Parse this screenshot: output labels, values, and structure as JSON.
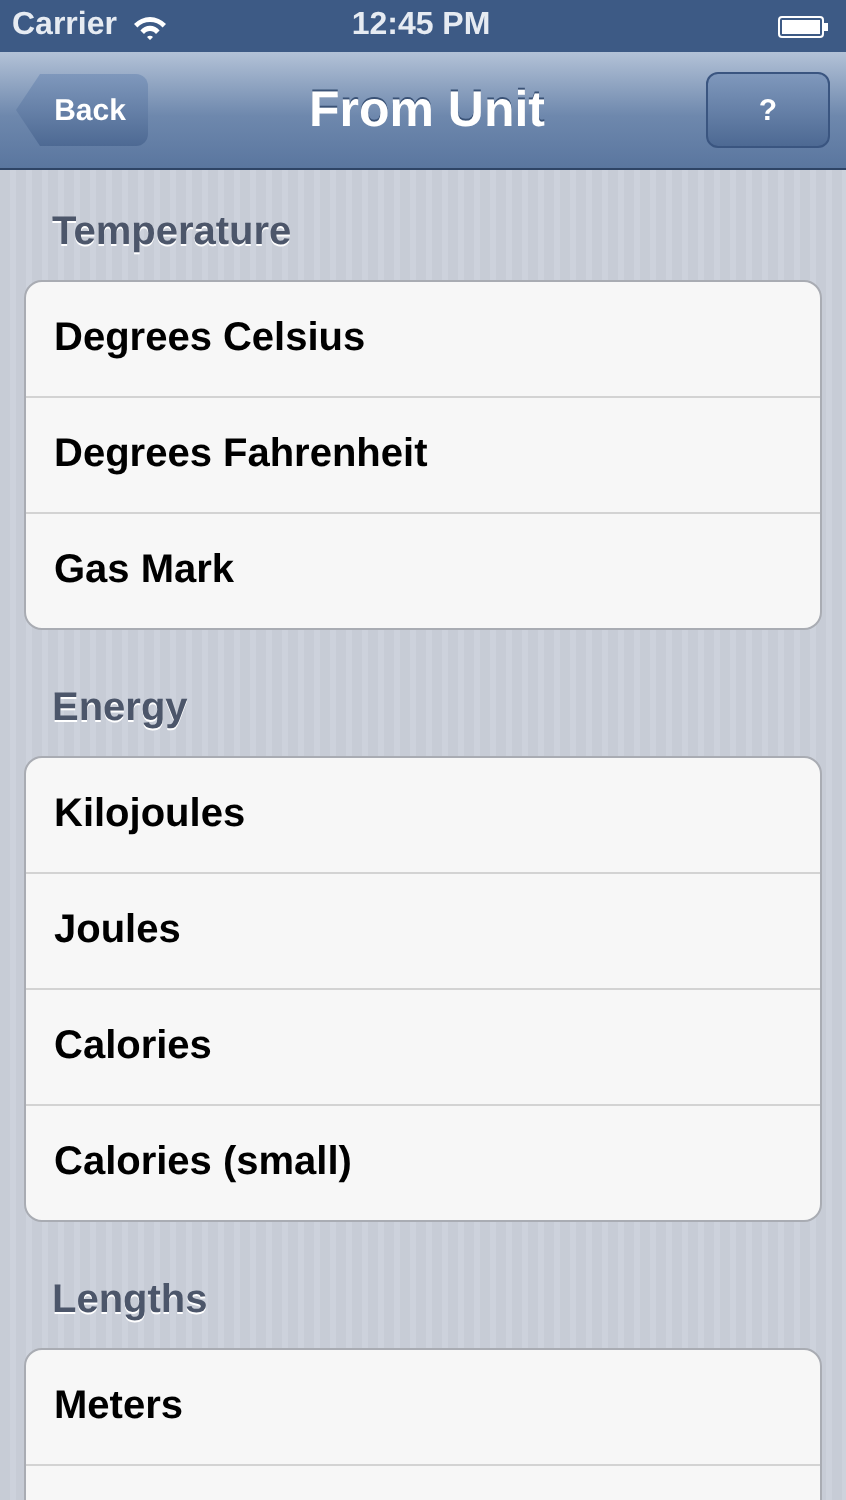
{
  "status_bar": {
    "carrier": "Carrier",
    "time": "12:45 PM"
  },
  "nav_bar": {
    "back": "Back",
    "title": "From Unit",
    "help": "?"
  },
  "sections": [
    {
      "header": "Temperature",
      "items": [
        "Degrees Celsius",
        "Degrees Fahrenheit",
        "Gas Mark"
      ]
    },
    {
      "header": "Energy",
      "items": [
        "Kilojoules",
        "Joules",
        "Calories",
        "Calories (small)"
      ]
    },
    {
      "header": "Lengths",
      "items": [
        "Meters"
      ]
    }
  ]
}
